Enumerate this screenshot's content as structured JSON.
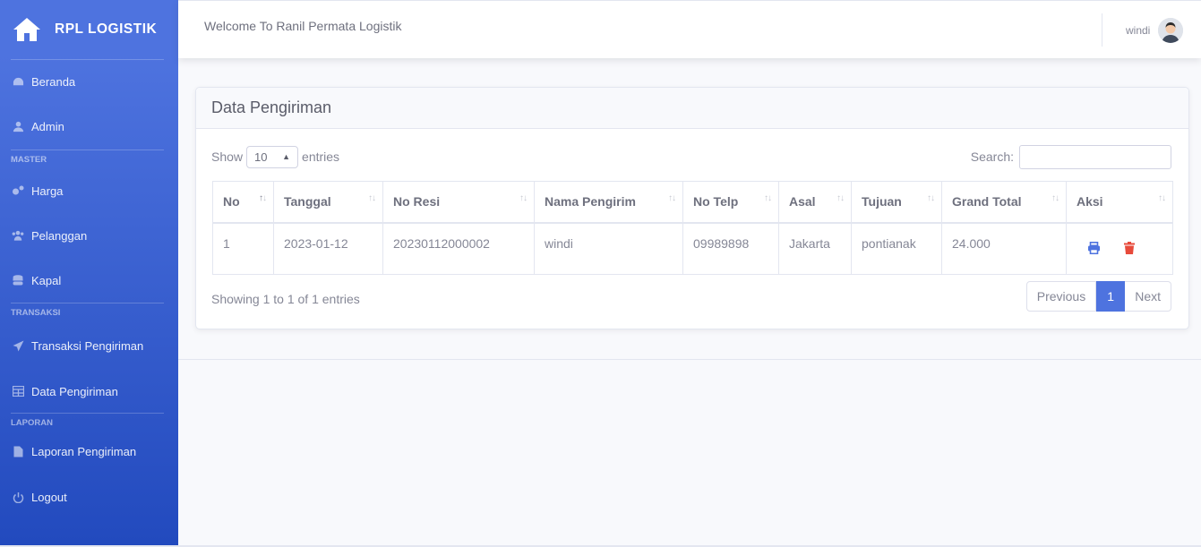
{
  "sidebar": {
    "brand": "RPL LOGISTIK",
    "items": [
      {
        "label": "Beranda",
        "icon": "dashboard-icon"
      },
      {
        "label": "Admin",
        "icon": "user-icon"
      }
    ],
    "master_heading": "MASTER",
    "master_items": [
      {
        "label": "Harga",
        "icon": "cogs-icon"
      },
      {
        "label": "Pelanggan",
        "icon": "users-icon"
      },
      {
        "label": "Kapal",
        "icon": "database-icon"
      }
    ],
    "transaksi_heading": "TRANSAKSI",
    "transaksi_items": [
      {
        "label": "Transaksi Pengiriman",
        "icon": "paper-plane-icon"
      },
      {
        "label": "Data Pengiriman",
        "icon": "table-icon"
      }
    ],
    "laporan_heading": "LAPORAN",
    "laporan_items": [
      {
        "label": "Laporan Pengiriman",
        "icon": "file-icon"
      }
    ],
    "logout": {
      "label": "Logout",
      "icon": "power-icon"
    }
  },
  "topbar": {
    "welcome": "Welcome To Ranil Permata Logistik",
    "user": "windi"
  },
  "card": {
    "title": "Data Pengiriman",
    "show_label": "Show",
    "entries_value": "10",
    "entries_label": "entries",
    "search_label": "Search:",
    "columns": [
      "No",
      "Tanggal",
      "No Resi",
      "Nama Pengirim",
      "No Telp",
      "Asal",
      "Tujuan",
      "Grand Total",
      "Aksi"
    ],
    "rows": [
      {
        "no": "1",
        "tanggal": "2023-01-12",
        "resi": "20230112000002",
        "pengirim": "windi",
        "telp": "09989898",
        "asal": "Jakarta",
        "tujuan": "pontianak",
        "total": "24.000"
      }
    ],
    "info": "Showing 1 to 1 of 1 entries",
    "pagination": {
      "previous": "Previous",
      "current": "1",
      "next": "Next"
    }
  },
  "colors": {
    "primary": "#4e73df",
    "danger": "#e74a3b"
  }
}
